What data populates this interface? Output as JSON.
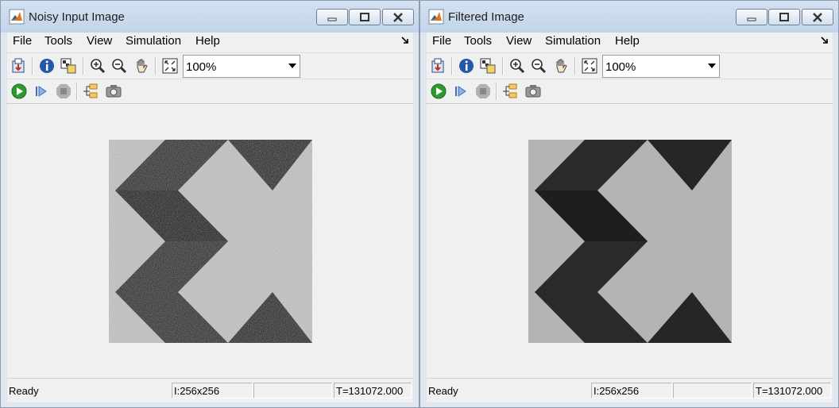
{
  "windows": [
    {
      "title": "Noisy Input Image",
      "menu": [
        "File",
        "Tools",
        "View",
        "Simulation",
        "Help"
      ],
      "zoom": "100%",
      "image": {
        "resolution": "256x256",
        "type": "noisy"
      },
      "status": {
        "text": "Ready",
        "size": "I:256x256",
        "empty": "",
        "time": "T=131072.000"
      }
    },
    {
      "title": "Filtered Image",
      "menu": [
        "File",
        "Tools",
        "View",
        "Simulation",
        "Help"
      ],
      "zoom": "100%",
      "image": {
        "resolution": "256x256",
        "type": "filtered"
      },
      "status": {
        "text": "Ready",
        "size": "I:256x256",
        "empty": "",
        "time": "T=131072.000"
      }
    }
  ],
  "toolbar1_icons": [
    "print-to-figure-icon",
    "info-icon",
    "pixel-region-icon",
    "zoom-in-icon",
    "zoom-out-icon",
    "pan-icon",
    "fit-to-view-icon"
  ],
  "toolbar2_icons": [
    "run-icon",
    "step-forward-icon",
    "stop-icon",
    "highlight-block-icon",
    "snapshot-icon"
  ],
  "colors": {
    "image_dark": "#2a2a2a",
    "image_light": "#b4b4b4",
    "run_green": "#2e9b2e"
  }
}
